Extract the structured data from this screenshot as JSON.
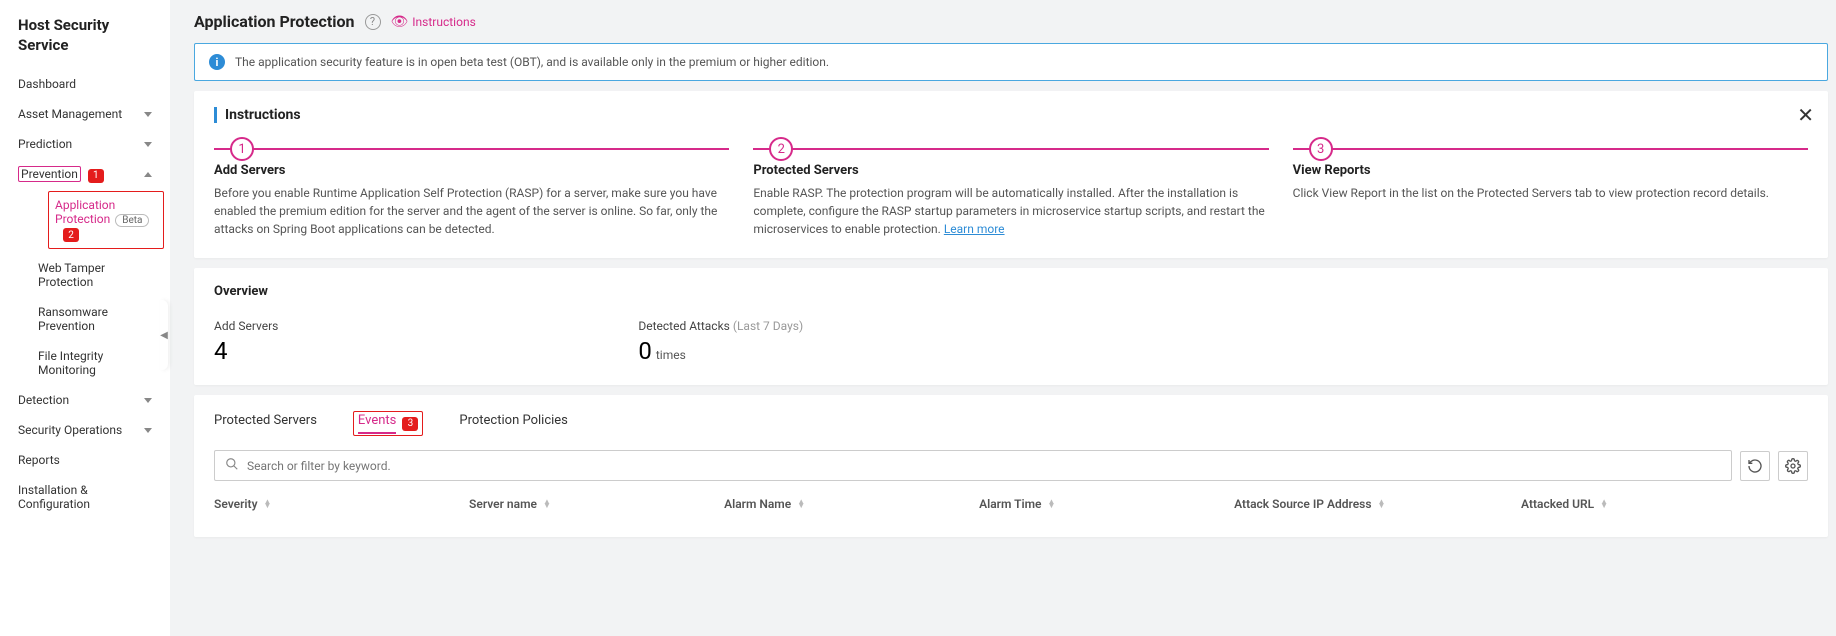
{
  "sidebar": {
    "title": "Host Security Service",
    "items": [
      {
        "label": "Dashboard",
        "expandable": false
      },
      {
        "label": "Asset Management",
        "expandable": true
      },
      {
        "label": "Prediction",
        "expandable": true
      },
      {
        "label": "Prevention",
        "expandable": true,
        "expanded": true,
        "badge": "1",
        "children": [
          {
            "label": "Application Protection",
            "beta": "Beta",
            "active": true,
            "badge": "2"
          },
          {
            "label": "Web Tamper Protection"
          },
          {
            "label": "Ransomware Prevention"
          },
          {
            "label": "File Integrity Monitoring"
          }
        ]
      },
      {
        "label": "Detection",
        "expandable": true
      },
      {
        "label": "Security Operations",
        "expandable": true
      },
      {
        "label": "Reports",
        "expandable": false
      },
      {
        "label": "Installation & Configuration",
        "expandable": false
      }
    ]
  },
  "page": {
    "title": "Application Protection",
    "instructions_link": "Instructions"
  },
  "banner": {
    "text": "The application security feature is in open beta test (OBT), and is available only in the premium or higher edition."
  },
  "instruction_card": {
    "title": "Instructions",
    "steps": [
      {
        "num": "1",
        "title": "Add Servers",
        "body": "Before you enable Runtime Application Self Protection (RASP) for a server, make sure you have enabled the premium edition for the server and the agent of the server is online. So far, only the attacks on Spring Boot applications can be detected."
      },
      {
        "num": "2",
        "title": "Protected Servers",
        "body": "Enable RASP. The protection program will be automatically installed. After the installation is complete, configure the RASP startup parameters in microservice startup scripts, and restart the microservices to enable protection.",
        "link": "Learn more"
      },
      {
        "num": "3",
        "title": "View Reports",
        "body": "Click View Report in the list on the Protected Servers tab to view protection record details."
      }
    ]
  },
  "overview": {
    "title": "Overview",
    "items": [
      {
        "label": "Add Servers",
        "value": "4",
        "unit": ""
      },
      {
        "label": "Detected Attacks",
        "suffix": "(Last 7 Days)",
        "value": "0",
        "unit": "times"
      }
    ]
  },
  "tabs": {
    "items": [
      {
        "label": "Protected Servers",
        "active": false
      },
      {
        "label": "Events",
        "active": true,
        "badge": "3"
      },
      {
        "label": "Protection Policies",
        "active": false
      }
    ]
  },
  "search": {
    "placeholder": "Search or filter by keyword."
  },
  "table": {
    "columns": [
      "Severity",
      "Server name",
      "Alarm Name",
      "Alarm Time",
      "Attack Source IP Address",
      "Attacked URL"
    ]
  }
}
